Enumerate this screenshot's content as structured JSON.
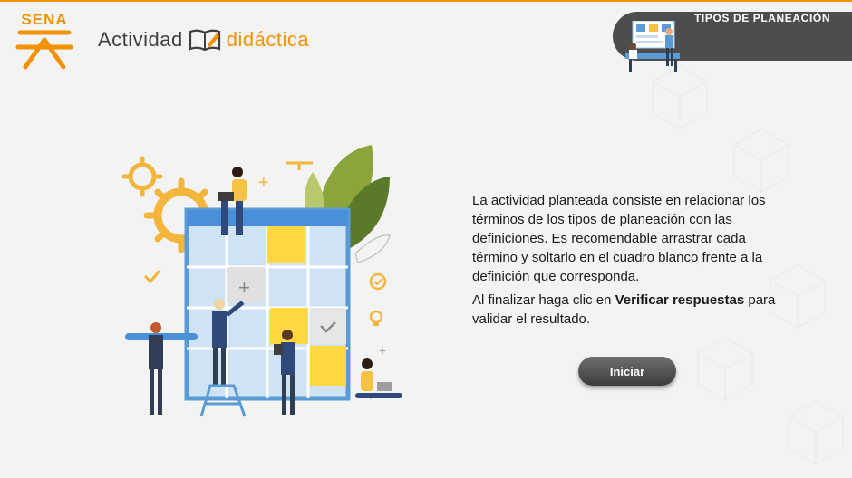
{
  "header": {
    "logo_text": "SENA",
    "brand_left": "Actividad",
    "brand_right": "didáctica",
    "topic": "TIPOS DE PLANEACIÓN"
  },
  "instructions": {
    "paragraph1": "La actividad planteada consiste en relacionar los términos de los tipos de planeación con las definiciones.  Es recomendable arrastrar cada término y soltarlo en el cuadro blanco frente a la definición que corresponda.",
    "paragraph2_before": "Al finalizar haga clic en ",
    "paragraph2_bold": "Verificar respuestas",
    "paragraph2_after": " para validar el resultado."
  },
  "start_button": {
    "label": "Iniciar"
  },
  "colors": {
    "accent_orange": "#f39200",
    "dark_gray": "#4d4d4d",
    "calendar_blue": "#5b9bd5",
    "sticky_yellow": "#ffd740"
  },
  "icons": [
    "sena-logo-icon",
    "open-book-pencil-icon",
    "team-planning-illustration",
    "calendar-board-illustration"
  ]
}
